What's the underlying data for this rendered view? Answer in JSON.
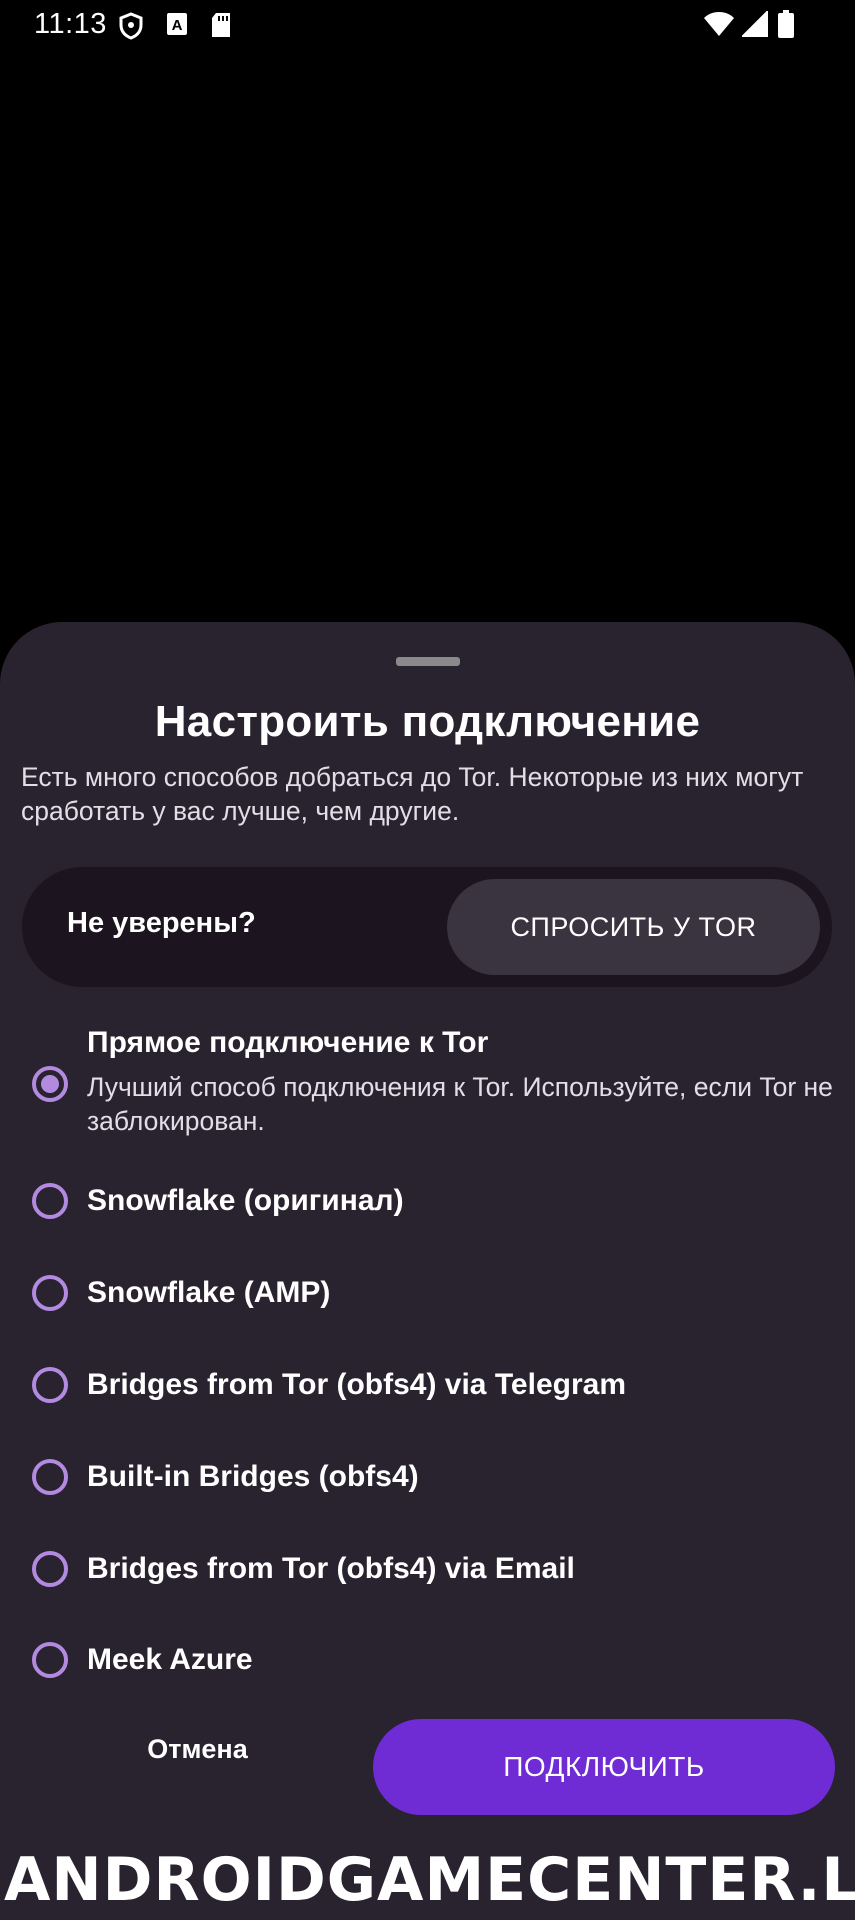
{
  "status_bar": {
    "time": "11:13",
    "icons": [
      "vpn-shield-icon",
      "a-notification-icon",
      "sd-card-icon",
      "wifi-icon",
      "signal-icon",
      "battery-icon"
    ]
  },
  "sheet": {
    "title": "Настроить подключение",
    "description": "Есть много способов добраться до Tor. Некоторые из них могут сработать у вас лучше, чем другие.",
    "ask": {
      "label": "Не уверены?",
      "button": "СПРОСИТЬ У TOR"
    },
    "options": [
      {
        "label": "Прямое подключение к Tor",
        "description": "Лучший способ подключения к Tor. Используйте, если Tor не заблокирован.",
        "selected": true
      },
      {
        "label": "Snowflake (оригинал)",
        "selected": false
      },
      {
        "label": "Snowflake (AMP)",
        "selected": false
      },
      {
        "label": "Bridges from Tor (obfs4) via Telegram",
        "selected": false
      },
      {
        "label": "Built-in Bridges (obfs4)",
        "selected": false
      },
      {
        "label": "Bridges from Tor (obfs4) via Email",
        "selected": false
      },
      {
        "label": "Meek Azure",
        "selected": false
      }
    ],
    "cancel": "Отмена",
    "connect": "ПОДКЛЮЧИТЬ"
  },
  "watermark": "ANDROIDGAMECENTER.LAT",
  "colors": {
    "sheet_bg": "#29222f",
    "accent": "#6f2bd4",
    "radio": "#b28ae0"
  }
}
